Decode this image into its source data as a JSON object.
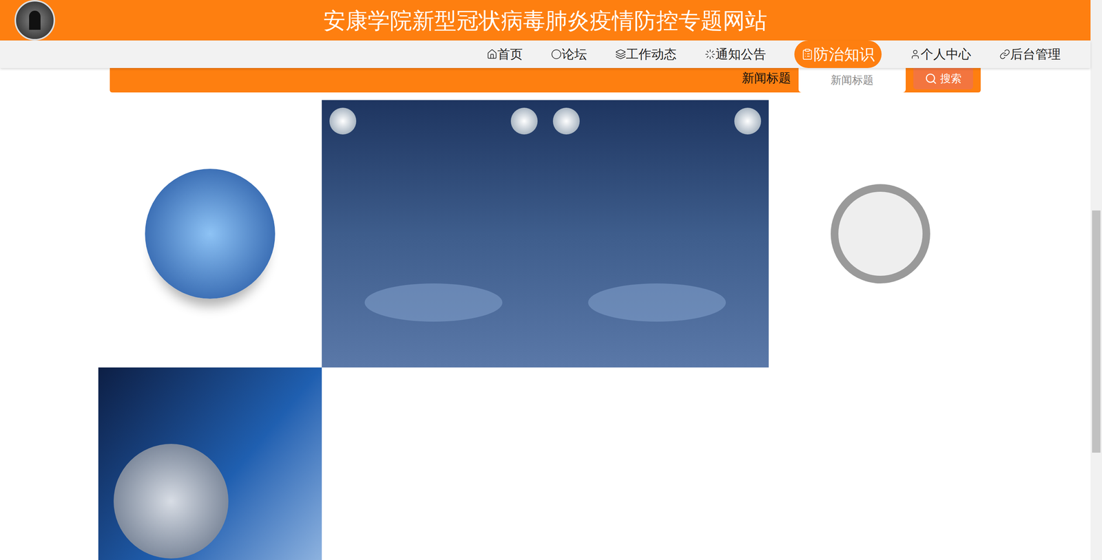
{
  "header": {
    "title": "安康学院新型冠状病毒肺炎疫情防控专题网站"
  },
  "nav": [
    {
      "label": "首页",
      "icon": "home",
      "selected": false
    },
    {
      "label": "论坛",
      "icon": "forum",
      "selected": false
    },
    {
      "label": "工作动态",
      "icon": "layers",
      "selected": false
    },
    {
      "label": "通知公告",
      "icon": "notice",
      "selected": false
    },
    {
      "label": "防治知识",
      "icon": "knowledge",
      "selected": true
    },
    {
      "label": "个人中心",
      "icon": "user",
      "selected": false
    },
    {
      "label": "后台管理",
      "icon": "link",
      "selected": false
    }
  ],
  "search": {
    "label": "新闻标题",
    "placeholder": "新闻标题",
    "button": "搜索"
  },
  "news": [
    {
      "kind": "globe"
    },
    {
      "kind": "spotlight"
    },
    {
      "kind": "spotlight"
    },
    {
      "kind": "magnifier"
    },
    {
      "kind": "studio"
    }
  ]
}
